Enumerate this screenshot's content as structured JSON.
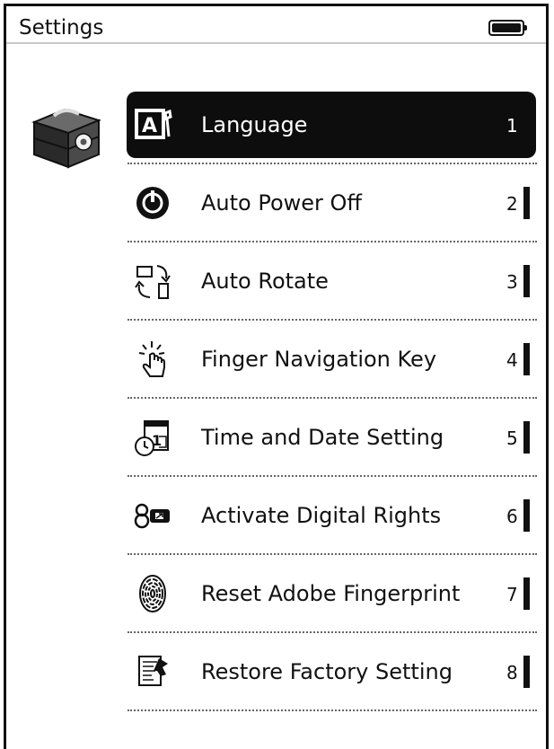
{
  "header": {
    "title": "Settings",
    "battery_icon": "battery-full-icon"
  },
  "sidebar": {
    "icon": "settings-toolbox-icon"
  },
  "menu": {
    "items": [
      {
        "label": "Language",
        "number": "1",
        "icon": "language-icon",
        "selected": true
      },
      {
        "label": "Auto Power Off",
        "number": "2",
        "icon": "power-icon",
        "selected": false
      },
      {
        "label": "Auto Rotate",
        "number": "3",
        "icon": "rotate-icon",
        "selected": false
      },
      {
        "label": "Finger Navigation Key",
        "number": "4",
        "icon": "finger-tap-icon",
        "selected": false
      },
      {
        "label": "Time and Date Setting",
        "number": "5",
        "icon": "calendar-clock-icon",
        "selected": false
      },
      {
        "label": "Activate Digital Rights",
        "number": "6",
        "icon": "digital-rights-icon",
        "selected": false
      },
      {
        "label": "Reset Adobe Fingerprint",
        "number": "7",
        "icon": "fingerprint-icon",
        "selected": false
      },
      {
        "label": "Restore Factory Setting",
        "number": "8",
        "icon": "restore-factory-icon",
        "selected": false
      }
    ]
  }
}
